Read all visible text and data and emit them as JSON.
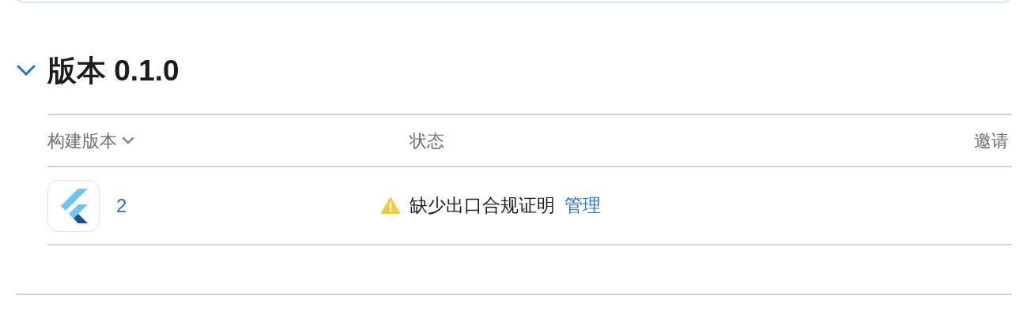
{
  "section": {
    "title": "版本 0.1.0",
    "expanded": true
  },
  "table": {
    "columns": [
      {
        "label": "构建版本",
        "sortable": true
      },
      {
        "label": "状态",
        "sortable": false
      },
      {
        "label": "邀请",
        "sortable": false
      }
    ],
    "rows": [
      {
        "build": "2",
        "status": "缺少出口合规证明",
        "kind": "warning",
        "action": "管理"
      }
    ]
  }
}
